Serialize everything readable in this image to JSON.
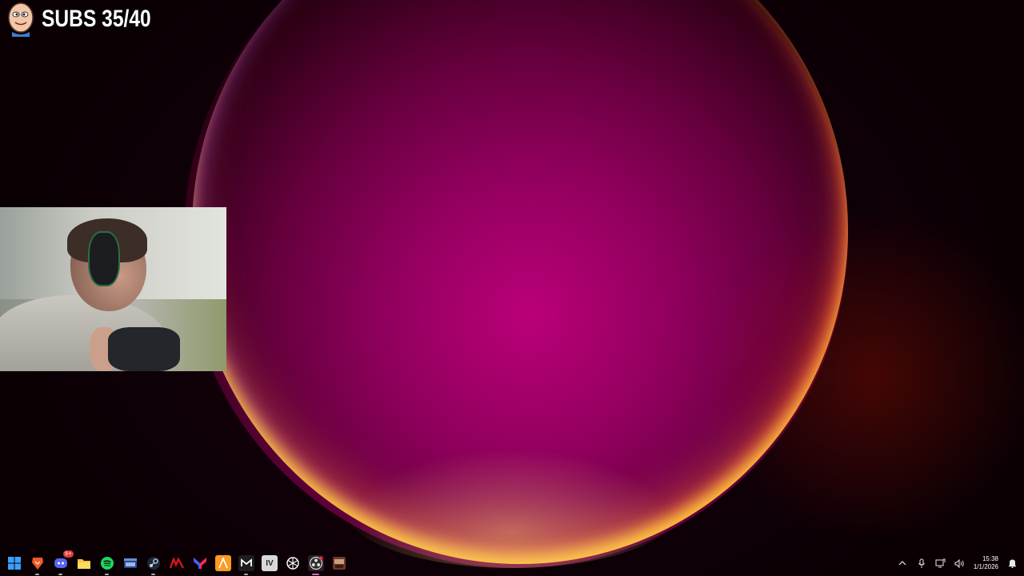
{
  "overlay": {
    "subs_text": "SUBS 35/40"
  },
  "taskbar": {
    "apps": [
      {
        "name": "start-button",
        "icon": "windows-logo-icon",
        "color": "#3aa0ff"
      },
      {
        "name": "brave-browser",
        "icon": "brave-lion-icon",
        "color": "#f15a24"
      },
      {
        "name": "discord",
        "icon": "discord-icon",
        "color": "#5865f2",
        "badge": "9+"
      },
      {
        "name": "file-explorer",
        "icon": "folder-icon",
        "color": "#f5c242"
      },
      {
        "name": "spotify",
        "icon": "spotify-icon",
        "color": "#1ed760"
      },
      {
        "name": "app-window",
        "icon": "window-icon",
        "color": "#6a8fd8"
      },
      {
        "name": "steam",
        "icon": "steam-icon",
        "color": "#c7d5e0"
      },
      {
        "name": "msi-afterburner",
        "icon": "msi-icon",
        "color": "#d4151b"
      },
      {
        "name": "yahtzee-app",
        "icon": "y-logo-icon",
        "color": "#ff2a55"
      },
      {
        "name": "affinity-app",
        "icon": "a-logo-icon",
        "color": "#ff9a1f"
      },
      {
        "name": "ea-app",
        "icon": "m-logo-icon",
        "color": "#2c2c2c"
      },
      {
        "name": "iv-app",
        "icon": "iv-logo-icon",
        "color": "#d9d9d9",
        "text": "IV"
      },
      {
        "name": "chatgpt",
        "icon": "chatgpt-icon",
        "color": "#ffffff"
      },
      {
        "name": "obs-studio",
        "icon": "obs-icon",
        "color": "#2b2b2b",
        "active": true
      },
      {
        "name": "game-app",
        "icon": "game-thumbnail-icon",
        "color": "#6b3a2a"
      }
    ]
  },
  "tray": {
    "time": "15:38",
    "date": "1/1/2026"
  }
}
